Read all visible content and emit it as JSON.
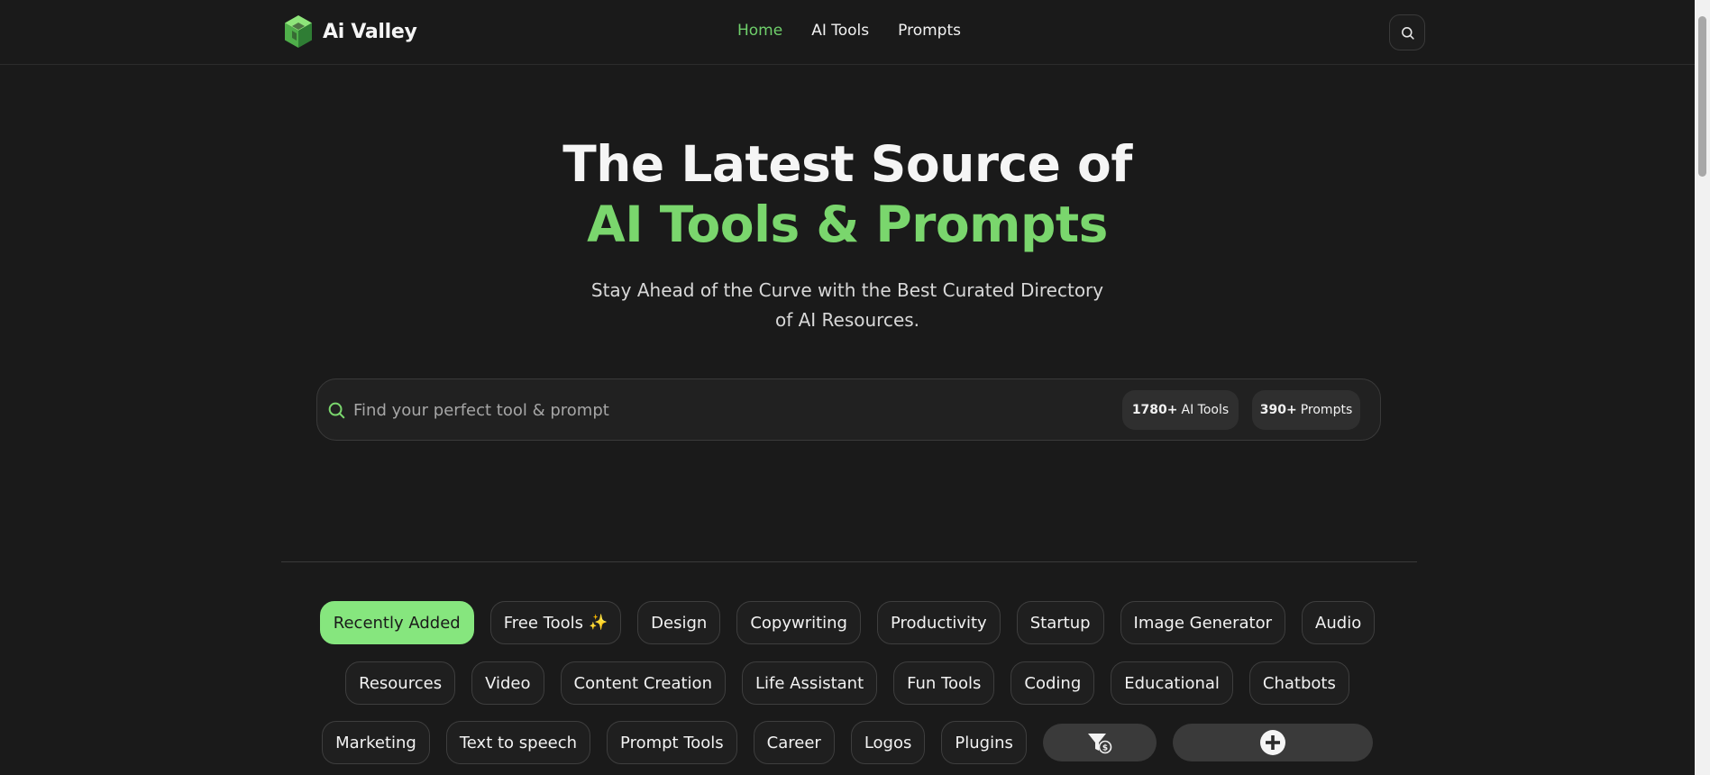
{
  "header": {
    "logo_text": "Ai Valley",
    "nav": [
      {
        "label": "Home",
        "active": true
      },
      {
        "label": "AI Tools",
        "active": false
      },
      {
        "label": "Prompts",
        "active": false
      }
    ],
    "search_icon": "search-icon"
  },
  "hero": {
    "title_line1": "The Latest Source of",
    "title_line2": "AI Tools & Prompts",
    "subtitle_line1": "Stay Ahead of the Curve with the Best Curated Directory",
    "subtitle_line2": "of AI Resources."
  },
  "search": {
    "placeholder": "Find your perfect tool & prompt",
    "value": "",
    "tools_count": "1780+",
    "tools_label": "AI Tools",
    "prompts_count": "390+",
    "prompts_label": "Prompts"
  },
  "categories": {
    "row1": [
      {
        "label": "Recently Added",
        "active": true
      },
      {
        "label": "Free Tools",
        "icon": "✨"
      },
      {
        "label": "Design"
      },
      {
        "label": "Copywriting"
      },
      {
        "label": "Productivity"
      },
      {
        "label": "Startup"
      },
      {
        "label": "Image Generator"
      },
      {
        "label": "Audio"
      }
    ],
    "row2": [
      {
        "label": "Resources"
      },
      {
        "label": "Video"
      },
      {
        "label": "Content Creation"
      },
      {
        "label": "Life Assistant"
      },
      {
        "label": "Fun Tools"
      },
      {
        "label": "Coding"
      },
      {
        "label": "Educational"
      },
      {
        "label": "Chatbots"
      }
    ],
    "row3": [
      {
        "label": "Marketing"
      },
      {
        "label": "Text to speech"
      },
      {
        "label": "Prompt Tools"
      },
      {
        "label": "Career"
      },
      {
        "label": "Logos"
      },
      {
        "label": "Plugins"
      }
    ]
  },
  "actions": {
    "filter_icon": "pricing-filter-icon",
    "add_icon": "plus-circle-icon"
  },
  "colors": {
    "background": "#1a1a1a",
    "accent": "#7ad66d",
    "active_chip": "#86e67e"
  }
}
